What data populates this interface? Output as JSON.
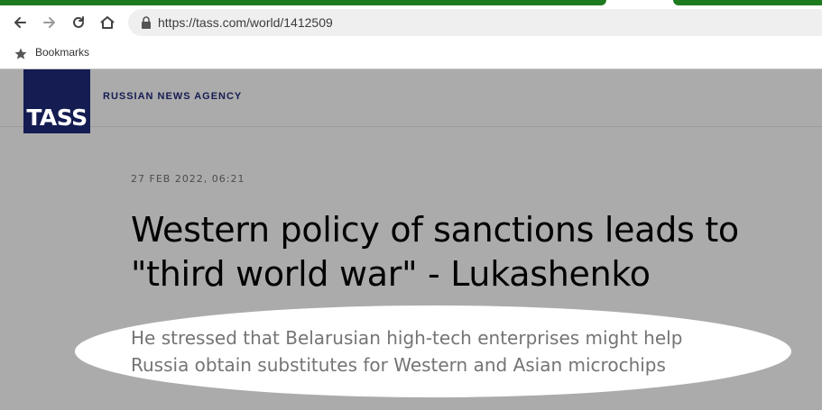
{
  "browser": {
    "url": "https://tass.com/world/1412509",
    "bookmarks_label": "Bookmarks",
    "tab_color": "#1e7a1e"
  },
  "site": {
    "logo_text": "TASS",
    "agency_name": "RUSSIAN NEWS AGENCY",
    "brand_color": "#141c52"
  },
  "article": {
    "date": "27 FEB 2022, 06:21",
    "headline": "Western policy of sanctions leads to \"third world war\" - Lukashenko",
    "lead": "He stressed that Belarusian high-tech enterprises might help Russia obtain substitutes for Western and Asian microchips"
  }
}
